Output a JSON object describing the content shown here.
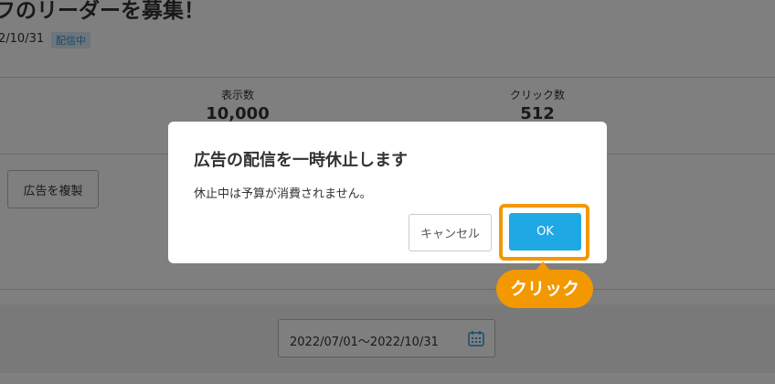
{
  "page": {
    "title": "フのリーダーを募集！",
    "date": "2/10/31",
    "status_badge": "配信中",
    "stats": [
      {
        "label": "表示数",
        "value": "10,000"
      },
      {
        "label": "クリック数",
        "value": "512"
      }
    ],
    "duplicate_button": "広告を複製",
    "date_range": "2022/07/01〜2022/10/31"
  },
  "dialog": {
    "title": "広告の配信を一時休止します",
    "message": "休止中は予算が消費されません。",
    "cancel_label": "キャンセル",
    "ok_label": "OK"
  },
  "annotation": {
    "callout": "クリック",
    "highlight_color": "#f39800"
  },
  "colors": {
    "primary": "#1ea8e4",
    "badge_text": "#3a8fc9",
    "badge_bg": "#d8ecf8"
  },
  "icons": {
    "date_field": "calendar-icon"
  }
}
